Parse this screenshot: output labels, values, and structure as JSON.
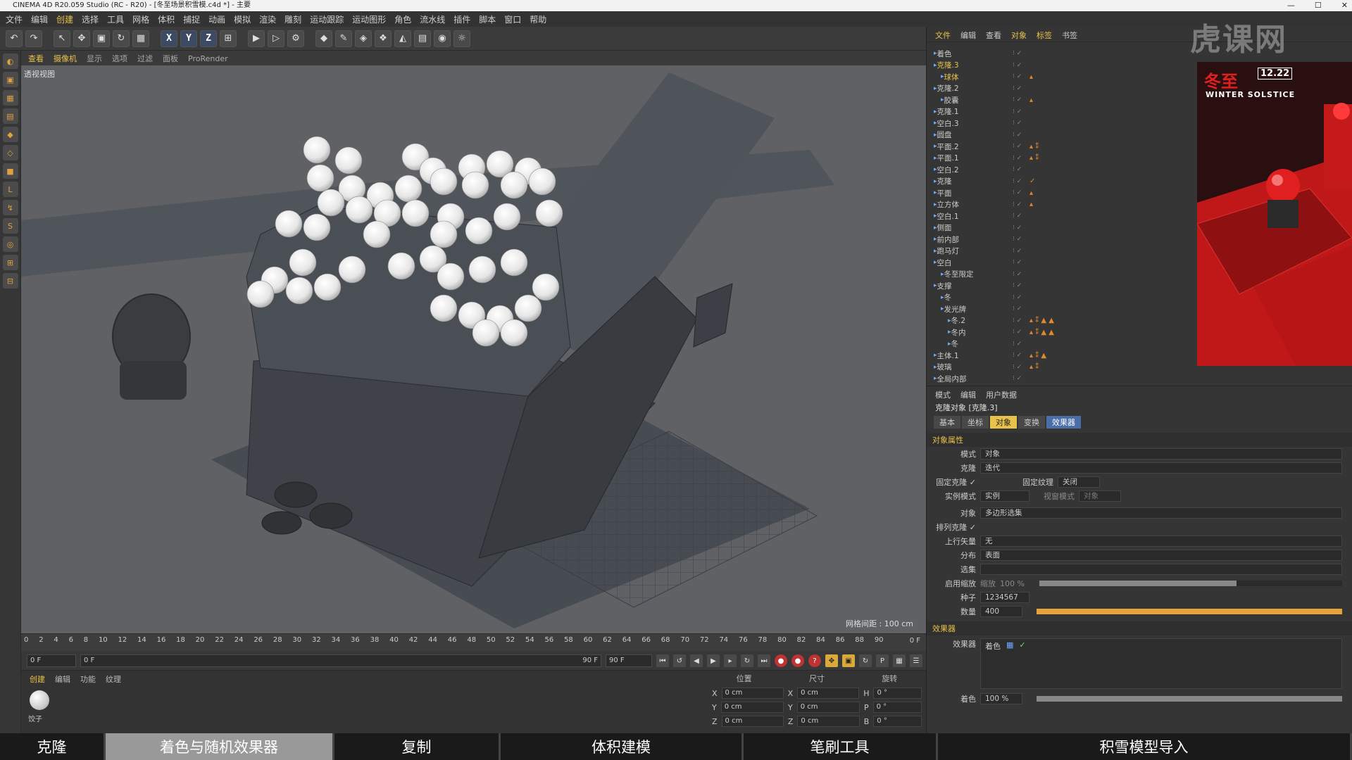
{
  "title": "CINEMA 4D R20.059 Studio (RC - R20) - [冬至场景积雪模.c4d *] - 主要",
  "window_buttons": [
    "—",
    "☐",
    "✕"
  ],
  "menubar": [
    "文件",
    "编辑",
    "创建",
    "选择",
    "工具",
    "网格",
    "体积",
    "捕捉",
    "动画",
    "模拟",
    "渲染",
    "雕刻",
    "运动跟踪",
    "运动图形",
    "角色",
    "流水线",
    "插件",
    "脚本",
    "窗口",
    "帮助"
  ],
  "toolbar_axes": [
    "X",
    "Y",
    "Z"
  ],
  "viewport": {
    "menu": [
      "查看",
      "摄像机",
      "显示",
      "选项",
      "过滤",
      "面板",
      "ProRender"
    ],
    "label": "透视视图",
    "grid_info": "网格间距 : 100 cm"
  },
  "timeline": {
    "ticks": [
      "0",
      "2",
      "4",
      "6",
      "8",
      "10",
      "12",
      "14",
      "16",
      "18",
      "20",
      "22",
      "24",
      "26",
      "28",
      "30",
      "32",
      "34",
      "36",
      "38",
      "40",
      "42",
      "44",
      "46",
      "48",
      "50",
      "52",
      "54",
      "56",
      "58",
      "60",
      "62",
      "64",
      "66",
      "68",
      "70",
      "72",
      "74",
      "76",
      "78",
      "80",
      "82",
      "84",
      "86",
      "88",
      "90"
    ],
    "end_label": "0 F",
    "start_field": "0 F",
    "range_start": "0 F",
    "range_end": "90 F",
    "end_field": "90 F"
  },
  "material_panel": {
    "tabs": [
      "创建",
      "编辑",
      "功能",
      "纹理"
    ],
    "material_name": "饺子"
  },
  "coord_panel": {
    "headers": [
      "位置",
      "尺寸",
      "旋转"
    ],
    "rows": [
      {
        "a": "X",
        "pos": "0 cm",
        "b": "X",
        "size": "0 cm",
        "c": "H",
        "rot": "0 °"
      },
      {
        "a": "Y",
        "pos": "0 cm",
        "b": "Y",
        "size": "0 cm",
        "c": "P",
        "rot": "0 °"
      },
      {
        "a": "Z",
        "pos": "0 cm",
        "b": "Z",
        "size": "0 cm",
        "c": "B",
        "rot": "0 °"
      }
    ]
  },
  "object_manager": {
    "menu": [
      "文件",
      "编辑",
      "查看",
      "对象",
      "标签",
      "书签"
    ],
    "objects": [
      "着色",
      "克隆.3",
      "球体",
      "克隆.2",
      "胶囊",
      "克隆.1",
      "空白.3",
      "圆盘",
      "平面.2",
      "平面.1",
      "空白.2",
      "克隆",
      "平面",
      "立方体",
      "空白.1",
      "侧面",
      "前内部",
      "跑马灯",
      "空白",
      "冬至限定",
      "支撑",
      "冬",
      "发光牌",
      "冬.2",
      "冬内",
      "冬",
      "主体.1",
      "玻璃",
      "全局内部"
    ]
  },
  "preview": {
    "logo": "冬至",
    "date": "12.22",
    "subtitle": "WINTER SOLSTICE"
  },
  "attributes": {
    "menu": [
      "模式",
      "编辑",
      "用户数据"
    ],
    "title": "克隆对象 [克隆.3]",
    "tabs": [
      "基本",
      "坐标",
      "对象",
      "变换",
      "效果器"
    ],
    "section_object": "对象属性",
    "mode_label": "模式",
    "mode_value": "对象",
    "clones_label": "克隆",
    "clones_value": "迭代",
    "fixed_clone": "固定克隆 ✓",
    "fixed_texture_label": "固定纹理",
    "fixed_texture_value": "关闭",
    "instance_label": "实例模式",
    "instance_value": "实例",
    "viewport_mode_label": "视窗模式",
    "viewport_mode_value": "对象",
    "object_label": "对象",
    "object_value": "多边形选集",
    "arrange_label": "排列克隆 ✓",
    "up_vector_label": "上行矢量",
    "up_vector_value": "无",
    "distribution_label": "分布",
    "distribution_value": "表面",
    "selection_label": "选集",
    "scale_label": "启用缩放",
    "scale_value_label": "缩放",
    "scale_value": "100 %",
    "seed_label": "种子",
    "seed_value": "1234567",
    "count_label": "数量",
    "count_value": "400",
    "section_effectors": "效果器",
    "effectors_label": "效果器",
    "effector_item": "着色",
    "color_label": "着色",
    "color_value": "100 %",
    "scale_fraction": 0.65,
    "count_fraction": 1.0,
    "color_fraction": 1.0
  },
  "bottom_tabs": [
    "克隆",
    "着色与随机效果器",
    "复制",
    "体积建模",
    "笔刷工具",
    "积雪模型导入"
  ],
  "watermark": "虎课网",
  "colors": {
    "accent": "#e8c24a",
    "preview_red": "#d61f1f",
    "viewport_bg": "#5f6165"
  }
}
